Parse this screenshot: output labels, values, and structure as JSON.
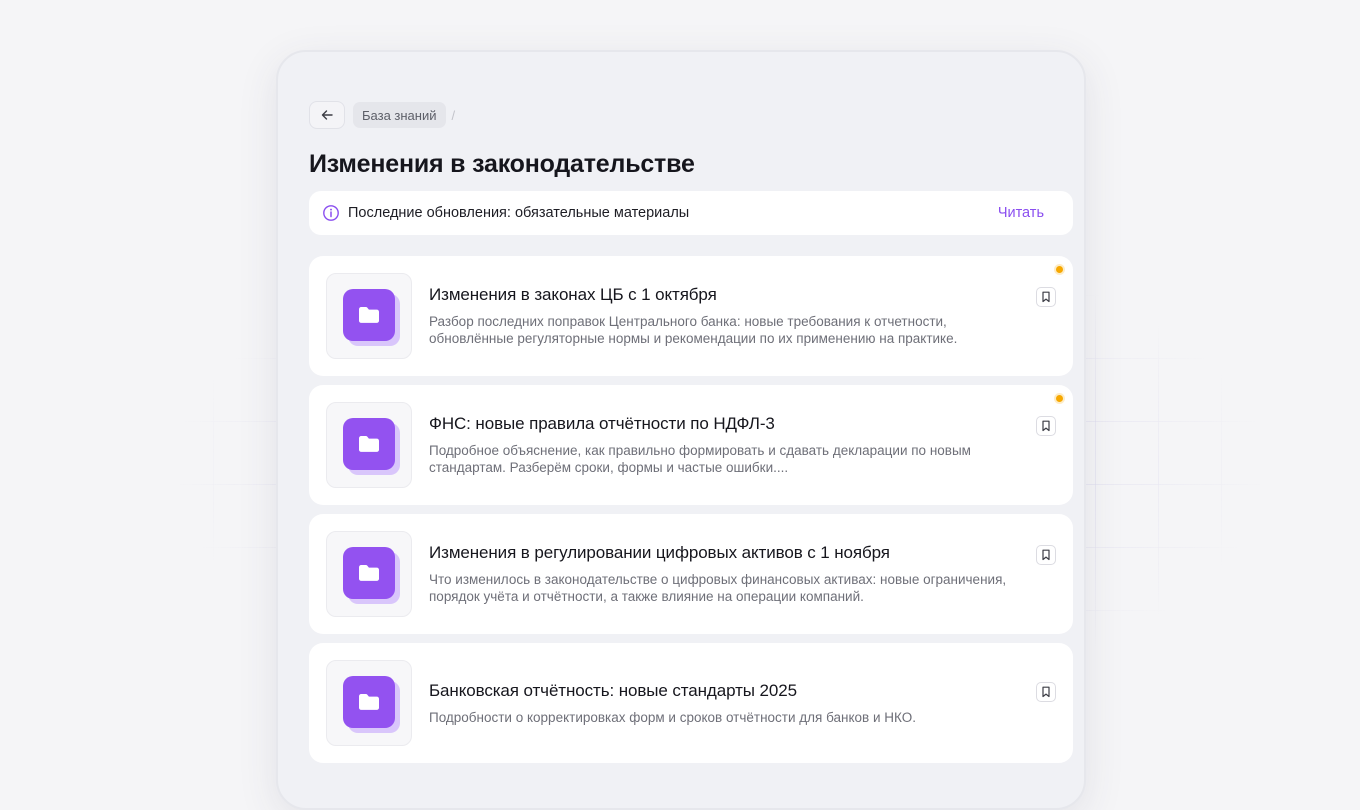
{
  "colors": {
    "accent": "#8b4ff0",
    "folder_tile": "#9352f0",
    "new_indicator": "#f7a800"
  },
  "header": {
    "back_icon": "arrow-left-icon",
    "breadcrumb": [
      "База знаний"
    ],
    "breadcrumb_separator": "/",
    "title": "Изменения в законодательстве"
  },
  "notice": {
    "icon": "info-circle-icon",
    "text": "Последние обновления: обязательные материалы",
    "action": "Читать"
  },
  "articles": [
    {
      "title": "Изменения в законах ЦБ с 1 октября",
      "description": "Разбор последних поправок Центрального банка: новые требования к отчетности, обновлённые регуляторные нормы и рекомендации по их применению на практике.",
      "is_new": true,
      "icon": "folder-icon",
      "bookmark_icon": "bookmark-icon"
    },
    {
      "title": "ФНС: новые правила отчётности по НДФЛ-3",
      "description": "Подробное объяснение, как правильно формировать и сдавать декларации по новым стандартам. Разберём сроки, формы и частые ошибки....",
      "is_new": true,
      "icon": "folder-icon",
      "bookmark_icon": "bookmark-icon"
    },
    {
      "title": "Изменения в регулировании цифровых активов с 1 ноября",
      "description": "Что изменилось в законодательстве о цифровых финансовых активах: новые ограничения, порядок учёта и отчётности, а также влияние на операции компаний.",
      "is_new": false,
      "icon": "folder-icon",
      "bookmark_icon": "bookmark-icon"
    },
    {
      "title": "Банковская отчётность: новые стандарты 2025",
      "description": "Подробности о корректировках форм и сроков отчётности для банков и НКО.",
      "is_new": false,
      "icon": "folder-icon",
      "bookmark_icon": "bookmark-icon"
    }
  ]
}
